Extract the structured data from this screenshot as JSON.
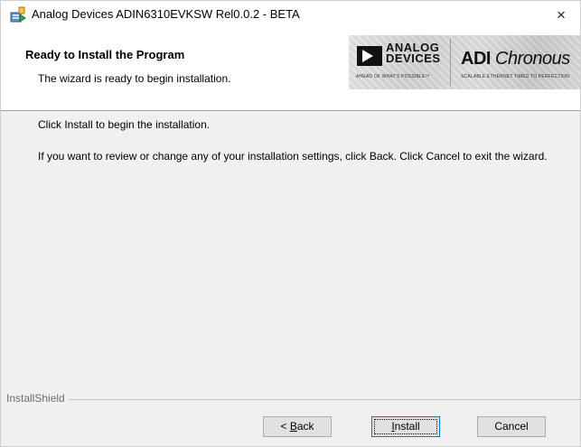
{
  "window": {
    "title": "Analog Devices ADIN6310EVKSW Rel0.0.2 - BETA",
    "close_glyph": "×",
    "icon": "installer-icon"
  },
  "header": {
    "title": "Ready to Install the Program",
    "subtitle": "The wizard is ready to begin installation."
  },
  "banner": {
    "adi_line1": "ANALOG",
    "adi_line2": "DEVICES",
    "adi_tagline": "AHEAD OF WHAT'S POSSIBLE™",
    "product_bold": "ADI",
    "product_italic": " Chronous",
    "product_tagline": "SCALABLE ETHERNET TIMED TO PERFECTION"
  },
  "body": {
    "line1": "Click Install to begin the installation.",
    "line2": "If you want to review or change any of your installation settings, click Back. Click Cancel to exit the wizard."
  },
  "footer": {
    "brand": "InstallShield"
  },
  "buttons": {
    "back_prefix": "< ",
    "back_hotkey": "B",
    "back_rest": "ack",
    "install_hotkey": "I",
    "install_rest": "nstall",
    "cancel": "Cancel"
  },
  "colors": {
    "dialog_bg": "#f0f0f0",
    "header_bg": "#ffffff",
    "focus_border": "#0078d7"
  }
}
